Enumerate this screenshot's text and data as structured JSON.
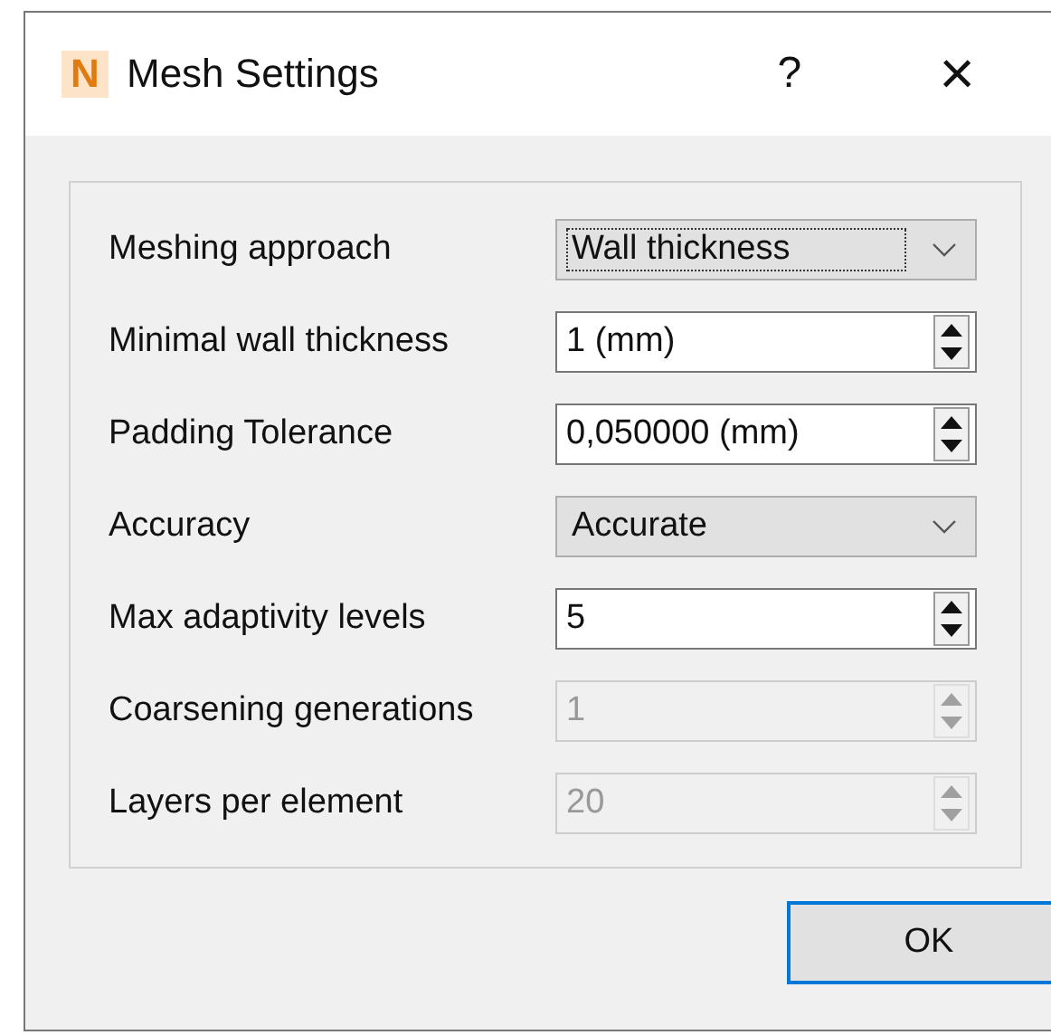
{
  "window": {
    "logo": "N",
    "title": "Mesh Settings",
    "help": "?",
    "close": "×"
  },
  "fields": [
    {
      "label": "Meshing approach",
      "kind": "combo",
      "value": "Wall thickness",
      "disabled": false,
      "focused": true
    },
    {
      "label": "Minimal wall thickness",
      "kind": "spin",
      "value": "1 (mm)",
      "disabled": false
    },
    {
      "label": "Padding Tolerance",
      "kind": "spin",
      "value": "0,050000 (mm)",
      "disabled": false
    },
    {
      "label": "Accuracy",
      "kind": "combo",
      "value": "Accurate",
      "disabled": false,
      "focused": false
    },
    {
      "label": "Max adaptivity levels",
      "kind": "spin",
      "value": "5",
      "disabled": false
    },
    {
      "label": "Coarsening generations",
      "kind": "spin",
      "value": "1",
      "disabled": true
    },
    {
      "label": "Layers per element",
      "kind": "spin",
      "value": "20",
      "disabled": true
    }
  ],
  "buttons": [
    "OK"
  ]
}
